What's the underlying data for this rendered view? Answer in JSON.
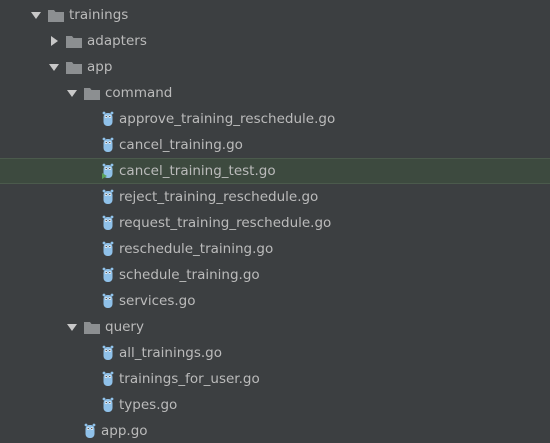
{
  "tree": {
    "items": [
      {
        "label": "trainings",
        "type": "folder",
        "expanded": true,
        "depth": 0,
        "selected": false,
        "icon": "folder-icon"
      },
      {
        "label": "adapters",
        "type": "folder",
        "expanded": false,
        "depth": 1,
        "selected": false,
        "icon": "folder-icon"
      },
      {
        "label": "app",
        "type": "folder",
        "expanded": true,
        "depth": 1,
        "selected": false,
        "icon": "folder-icon"
      },
      {
        "label": "command",
        "type": "folder",
        "expanded": true,
        "depth": 2,
        "selected": false,
        "icon": "folder-icon"
      },
      {
        "label": "approve_training_reschedule.go",
        "type": "go-file",
        "depth": 3,
        "selected": false,
        "icon": "gopher-file-icon"
      },
      {
        "label": "cancel_training.go",
        "type": "go-file",
        "depth": 3,
        "selected": false,
        "icon": "gopher-file-icon"
      },
      {
        "label": "cancel_training_test.go",
        "type": "go-test-file",
        "depth": 3,
        "selected": true,
        "icon": "gopher-test-file-icon"
      },
      {
        "label": "reject_training_reschedule.go",
        "type": "go-file",
        "depth": 3,
        "selected": false,
        "icon": "gopher-file-icon"
      },
      {
        "label": "request_training_reschedule.go",
        "type": "go-file",
        "depth": 3,
        "selected": false,
        "icon": "gopher-file-icon"
      },
      {
        "label": "reschedule_training.go",
        "type": "go-file",
        "depth": 3,
        "selected": false,
        "icon": "gopher-file-icon"
      },
      {
        "label": "schedule_training.go",
        "type": "go-file",
        "depth": 3,
        "selected": false,
        "icon": "gopher-file-icon"
      },
      {
        "label": "services.go",
        "type": "go-file",
        "depth": 3,
        "selected": false,
        "icon": "gopher-file-icon"
      },
      {
        "label": "query",
        "type": "folder",
        "expanded": true,
        "depth": 2,
        "selected": false,
        "icon": "folder-icon"
      },
      {
        "label": "all_trainings.go",
        "type": "go-file",
        "depth": 3,
        "selected": false,
        "icon": "gopher-file-icon"
      },
      {
        "label": "trainings_for_user.go",
        "type": "go-file",
        "depth": 3,
        "selected": false,
        "icon": "gopher-file-icon"
      },
      {
        "label": "types.go",
        "type": "go-file",
        "depth": 3,
        "selected": false,
        "icon": "gopher-file-icon"
      },
      {
        "label": "app.go",
        "type": "go-file",
        "depth": 2,
        "selected": false,
        "icon": "gopher-file-icon"
      }
    ]
  },
  "colors": {
    "background": "#3c3f41",
    "text": "#bbbbbb",
    "selection": "#3d4a3f",
    "folder": "#8c8f91",
    "gopher": "#8fc1e9",
    "test_marker": "#5aa05a"
  }
}
